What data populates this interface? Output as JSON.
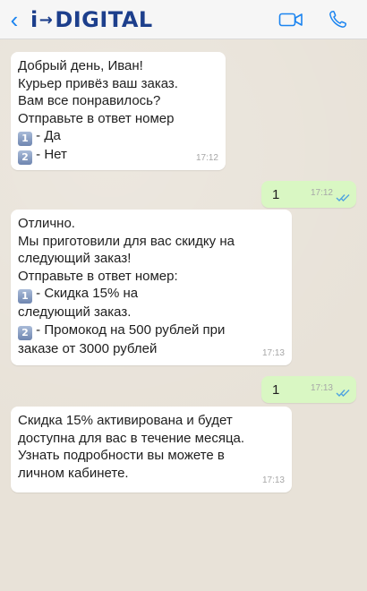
{
  "header": {
    "back_icon": "chevron-left-icon",
    "brand_prefix": "i",
    "brand_arrow": "→",
    "brand_name": "DIGITAL",
    "video_icon": "video-camera-icon",
    "phone_icon": "phone-icon",
    "accent_color": "#1b84f0",
    "brand_color": "#1d3f8c"
  },
  "messages": [
    {
      "direction": "in",
      "lines": [
        "Добрый день, Иван!",
        "Курьер привёз ваш заказ.",
        "Вам все понравилось?",
        "Отправьте в ответ номер"
      ],
      "options": [
        {
          "key": "1",
          "text": " - Да"
        },
        {
          "key": "2",
          "text": " - Нет"
        }
      ],
      "time": "17:12"
    },
    {
      "direction": "out",
      "text": "1",
      "time": "17:12",
      "status": "read"
    },
    {
      "direction": "in",
      "lines": [
        "Отлично.",
        "Мы приготовили для вас скидку на",
        "следующий заказ!",
        "Отправьте в ответ номер:"
      ],
      "options": [
        {
          "key": "1",
          "text": " - Скидка 15% на",
          "cont": "следующий заказ."
        },
        {
          "key": "2",
          "text": " - Промокод на 500 рублей при",
          "cont": "заказе от 3000 рублей"
        }
      ],
      "time": "17:13"
    },
    {
      "direction": "out",
      "text": "1",
      "time": "17:13",
      "status": "read"
    },
    {
      "direction": "in",
      "lines": [
        "Скидка 15% активирована и будет",
        "доступна для вас в течение месяца.",
        "Узнать подробности вы можете в",
        "личном кабинете."
      ],
      "time": "17:13"
    }
  ]
}
